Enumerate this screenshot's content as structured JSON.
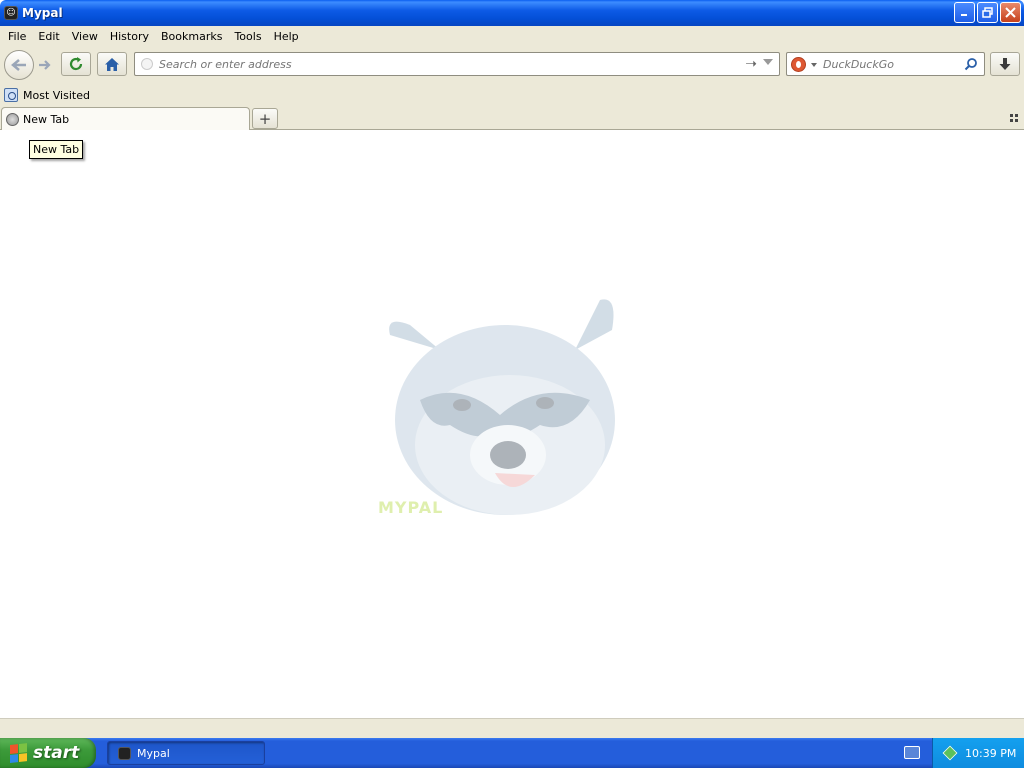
{
  "window": {
    "title": "Mypal",
    "controls": {
      "minimize": "minimize",
      "restore": "restore",
      "close": "close"
    }
  },
  "menu": {
    "items": [
      {
        "label": "File",
        "access": "F"
      },
      {
        "label": "Edit",
        "access": "E"
      },
      {
        "label": "View",
        "access": "V"
      },
      {
        "label": "History",
        "access": "H"
      },
      {
        "label": "Bookmarks",
        "access": "B"
      },
      {
        "label": "Tools",
        "access": "T"
      },
      {
        "label": "Help",
        "access": "H"
      }
    ]
  },
  "navigation": {
    "back_icon": "back-arrow-icon",
    "forward_icon": "forward-arrow-icon",
    "reload_icon": "reload-icon",
    "home_icon": "home-icon",
    "address_placeholder": "Search or enter address",
    "address_value": "",
    "search_engine": "DuckDuckGo",
    "search_placeholder": "DuckDuckGo",
    "download_icon": "download-icon"
  },
  "bookmarks": {
    "items": [
      {
        "label": "Most Visited"
      }
    ]
  },
  "tabs": {
    "items": [
      {
        "label": "New Tab",
        "active": true
      }
    ],
    "new_tab_symbol": "+",
    "tooltip": "New Tab"
  },
  "content": {
    "logo_text": "MYPAL",
    "logo_icon": "raccoon-logo"
  },
  "taskbar": {
    "start_label": "start",
    "window_button_label": "Mypal",
    "clock": "10:39 PM"
  },
  "colors": {
    "title_bar": "#0a5ef0",
    "taskbar": "#245edb",
    "start_button": "#3c9a3a",
    "chrome_bg": "#ece9d8"
  }
}
